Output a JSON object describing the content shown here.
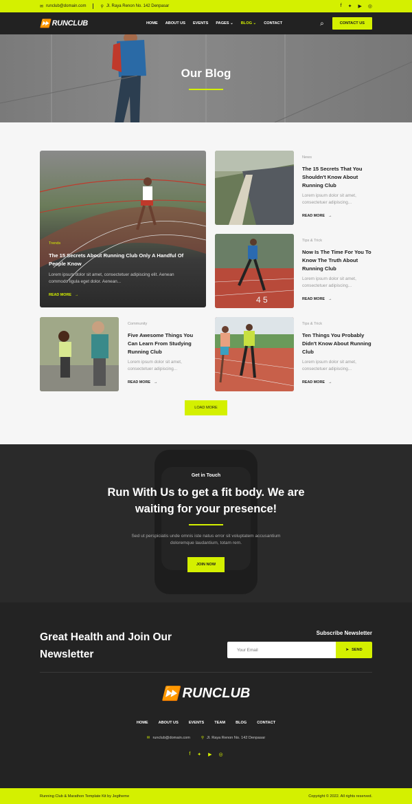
{
  "topbar": {
    "email": "runclub@domain.com",
    "address": "Jl. Raya Renon No. 142 Denpasar",
    "social_icons": [
      "facebook-icon",
      "twitter-icon",
      "youtube-icon",
      "instagram-icon"
    ]
  },
  "nav": {
    "logo": "RUNCLUB",
    "items": [
      "HOME",
      "ABOUT US",
      "EVENTS",
      "PAGES",
      "BLOG",
      "CONTACT"
    ],
    "active": "BLOG",
    "cta": "CONTACT US"
  },
  "hero": {
    "title": "Our Blog"
  },
  "blog": {
    "featured": {
      "tag": "Trends",
      "title": "The 15 Secrets About Running Club Only A Handful Of People Know",
      "excerpt": "Lorem ipsum dolor sit amet, consectetuer adipiscing elit. Aenean commodo ligula eget dolor. Aenean...",
      "read_more": "READ MORE"
    },
    "posts": [
      {
        "tag": "News",
        "title": "The 15 Secrets That You Shouldn't Know About Running Club",
        "excerpt": "Lorem ipsum dolor sit amet, consectetuer adipiscing...",
        "read_more": "READ MORE"
      },
      {
        "tag": "Tips & Trick",
        "title": "Now Is The Time For You To Know The Truth About Running Club",
        "excerpt": "Lorem ipsum dolor sit amet, consectetuer adipiscing...",
        "read_more": "READ MORE"
      },
      {
        "tag": "Community",
        "title": "Five Awesome Things You Can Learn From Studying Running Club",
        "excerpt": "Lorem ipsum dolor sit amet, consectetuer adipiscing...",
        "read_more": "READ MORE"
      },
      {
        "tag": "Tips & Trick",
        "title": "Ten Things You Probably Didn't Know About Running Club",
        "excerpt": "Lorem ipsum dolor sit amet, consectetuer adipiscing...",
        "read_more": "READ MORE"
      }
    ],
    "load_more": "LOAD MORE"
  },
  "touch": {
    "kicker": "Get in Touch",
    "title": "Run With Us to get a fit body. We are waiting for your presence!",
    "text": "Sed ut perspiciatis unde omnis iste natus error sit voluptatem accusantium doloremque laudantium, totam rem.",
    "button": "JOIN NOW"
  },
  "footer": {
    "headline": "Great Health and Join Our Newsletter",
    "subscribe_title": "Subscribe Newsletter",
    "email_placeholder": "Your Email",
    "send": "SEND",
    "logo": "RUNCLUB",
    "menu": [
      "HOME",
      "ABOUT US",
      "EVENTS",
      "TEAM",
      "BLOG",
      "CONTACT"
    ],
    "email": "runclub@domain.com",
    "address": "Jl. Raya Renon No. 142 Denpasar",
    "social_icons": [
      "facebook-icon",
      "twitter-icon",
      "youtube-icon",
      "instagram-icon"
    ]
  },
  "bottombar": {
    "left": "Running Club & Marathon Template Kit by Jegtheme",
    "right": "Copyright © 2022. All rights reserved."
  },
  "colors": {
    "accent": "#d4f000",
    "dark": "#232323"
  }
}
